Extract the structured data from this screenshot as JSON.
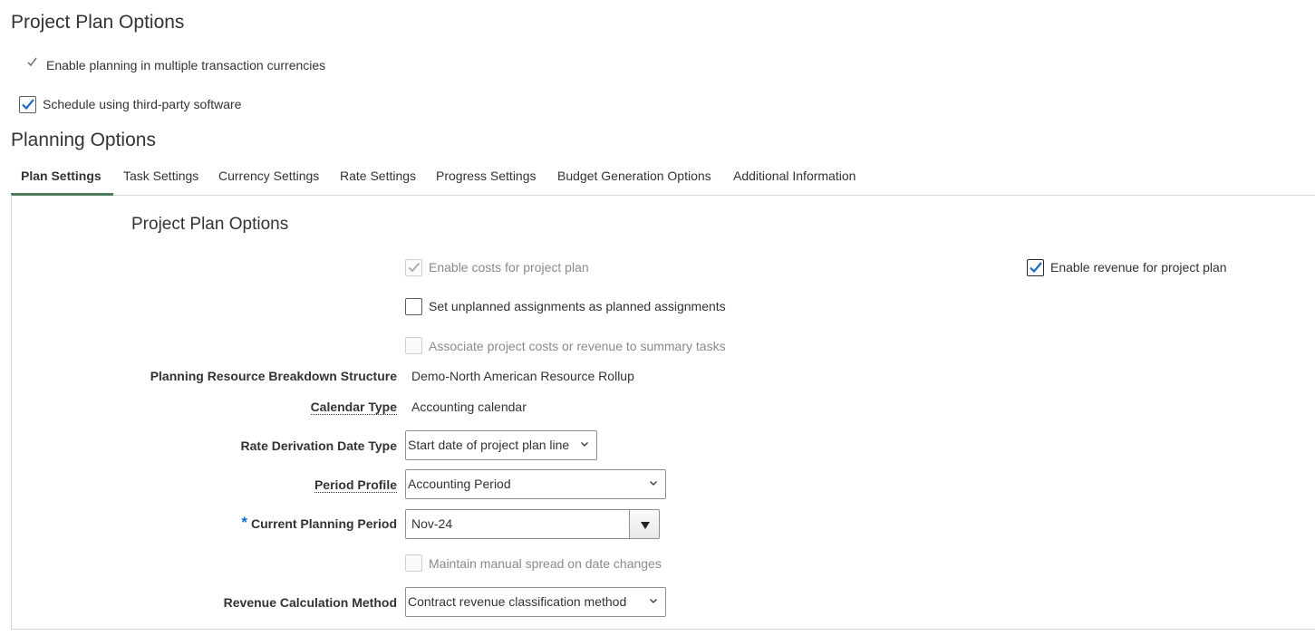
{
  "page_title": "Project Plan Options",
  "top_options": {
    "multi_currency_label": "Enable planning in multiple transaction currencies",
    "multi_currency_checked": true,
    "third_party_label": "Schedule using third-party software",
    "third_party_checked": true
  },
  "planning_section_title": "Planning Options",
  "tabs": [
    {
      "label": "Plan Settings",
      "active": true
    },
    {
      "label": "Task Settings",
      "active": false
    },
    {
      "label": "Currency Settings",
      "active": false
    },
    {
      "label": "Rate Settings",
      "active": false
    },
    {
      "label": "Progress Settings",
      "active": false
    },
    {
      "label": "Budget Generation Options",
      "active": false
    },
    {
      "label": "Additional Information",
      "active": false
    }
  ],
  "panel": {
    "title": "Project Plan Options",
    "enable_costs": {
      "label": "Enable costs for project plan",
      "checked": true,
      "disabled": true
    },
    "enable_revenue": {
      "label": "Enable revenue for project plan",
      "checked": true,
      "disabled": false
    },
    "unplanned_assignments": {
      "label": "Set unplanned assignments as planned assignments",
      "checked": false,
      "disabled": false
    },
    "associate_summary": {
      "label": "Associate project costs or revenue to summary tasks",
      "checked": false,
      "disabled": true
    },
    "rbs": {
      "label": "Planning Resource Breakdown Structure",
      "value": "Demo-North American Resource Rollup"
    },
    "calendar_type": {
      "label": "Calendar Type",
      "value": "Accounting calendar"
    },
    "rate_derivation": {
      "label": "Rate Derivation Date Type",
      "value": "Start date of project plan line"
    },
    "period_profile": {
      "label": "Period Profile",
      "value": "Accounting Period"
    },
    "current_period": {
      "required_marker": "*",
      "label": "Current Planning Period",
      "value": "Nov-24"
    },
    "manual_spread": {
      "label": "Maintain manual spread on date changes",
      "checked": false,
      "disabled": true
    },
    "revenue_method": {
      "label": "Revenue Calculation Method",
      "value": "Contract revenue classification method"
    }
  },
  "colors": {
    "check_blue": "#1a6cc9",
    "tab_underline": "#4e7a58",
    "required_star": "#0572ce"
  }
}
